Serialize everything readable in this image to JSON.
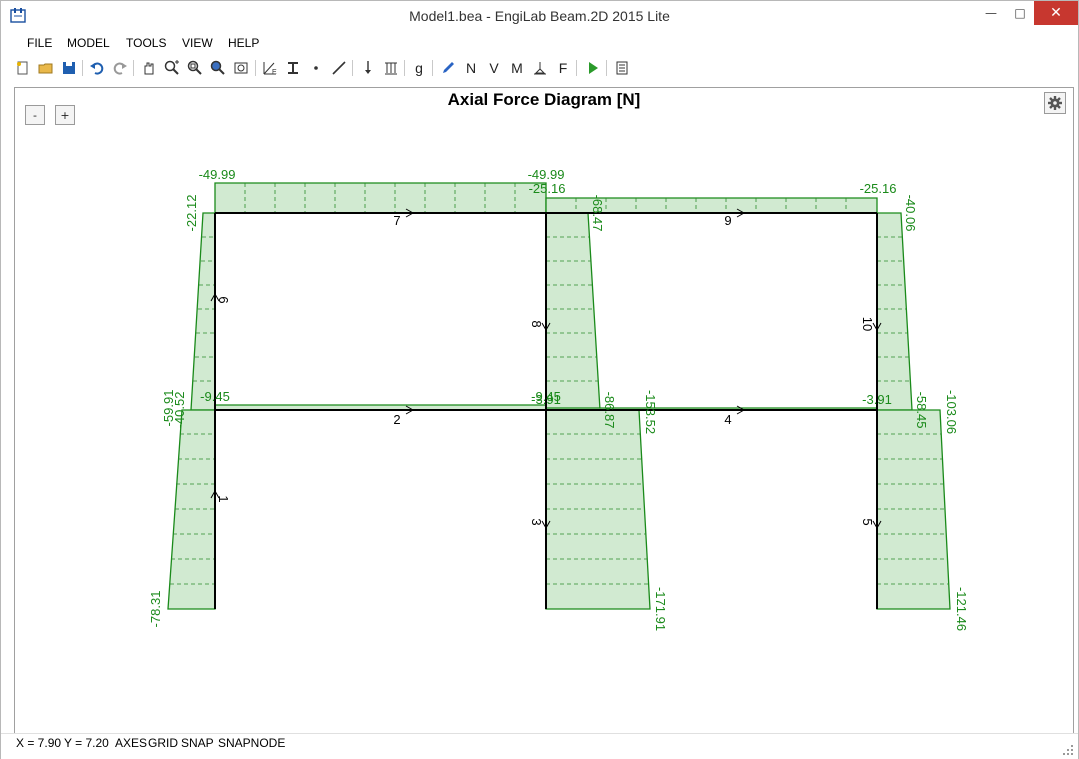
{
  "window": {
    "title": "Model1.bea - EngiLab Beam.2D 2015 Lite"
  },
  "menu": {
    "file": "FILE",
    "model": "MODEL",
    "tools": "TOOLS",
    "view": "VIEW",
    "help": "HELP"
  },
  "toolbar": {
    "n_label": "N",
    "v_label": "V",
    "m_label": "M",
    "f_label": "F",
    "g_label": "g"
  },
  "zoom": {
    "minus": "-",
    "plus": "+"
  },
  "diagram": {
    "title": "Axial Force Diagram [N]",
    "element_labels": {
      "e1": "1",
      "e2": "2",
      "e3": "3",
      "e4": "4",
      "e5": "5",
      "e6": "6",
      "e7": "7",
      "e8": "8",
      "e9": "9",
      "e10": "10"
    },
    "values": {
      "b7_left": "-49.99",
      "b7_right": "-49.99",
      "b9_left": "-25.16",
      "b9_right": "-25.16",
      "c6_top": "-22.12",
      "c6_bottom": "-40.52",
      "c1_top": "-59.91",
      "c1_bottom": "-78.31",
      "c8_top": "-68.47",
      "c8_bottom": "-86.87",
      "c3_top": "-153.52",
      "c3_bottom": "-171.91",
      "c10_top": "-40.06",
      "c10_bottom": "-58.45",
      "c5_top": "-103.06",
      "c5_bottom": "-121.46",
      "b2_left": "-9.45",
      "b2_right": "-9.45",
      "b4_left": "-3.91",
      "b4_right": "-3.91"
    }
  },
  "status": {
    "x": "X = 7.90",
    "y": "Y = 7.20",
    "axes": "AXES",
    "grid": "GRID",
    "snap": "SNAP",
    "snapnode": "SNAPNODE"
  }
}
